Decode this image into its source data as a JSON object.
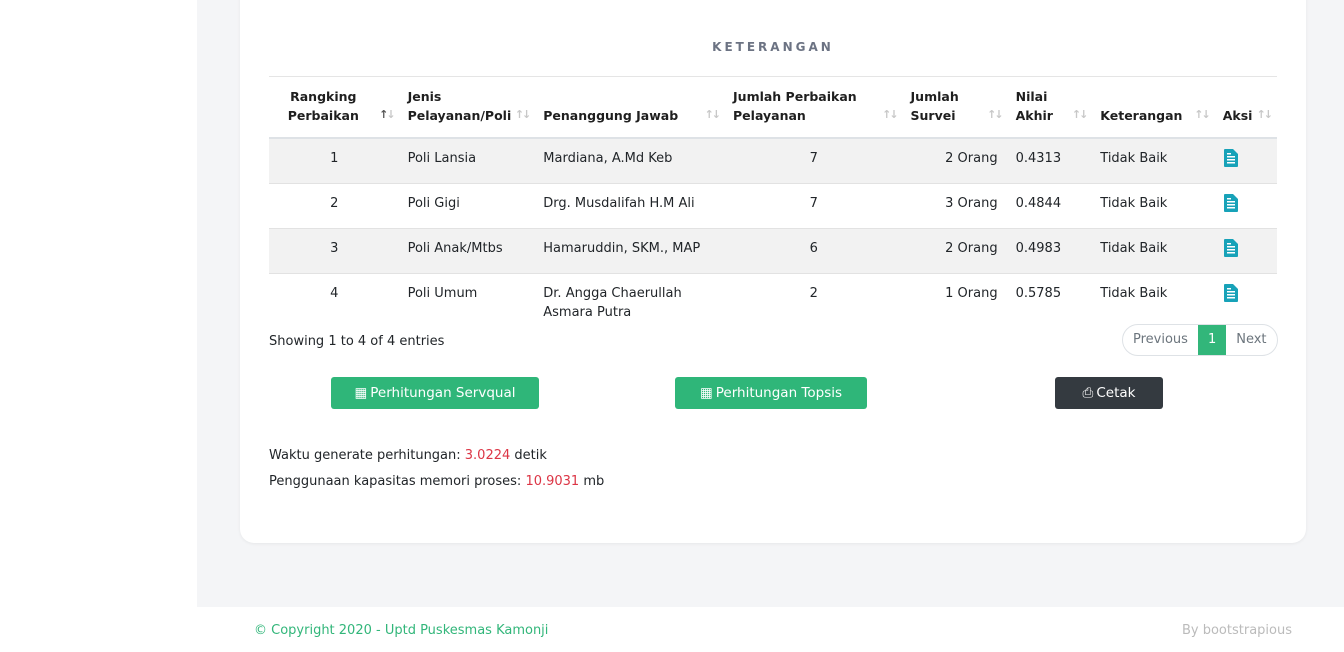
{
  "card": {
    "title": "KETERANGAN"
  },
  "table": {
    "headers": [
      {
        "line1": "Rangking",
        "line2": "Perbaikan"
      },
      {
        "line1": "Jenis",
        "line2": "Pelayanan/Poli"
      },
      {
        "line1": "",
        "line2": "Penanggung Jawab"
      },
      {
        "line1": "Jumlah Perbaikan",
        "line2": "Pelayanan"
      },
      {
        "line1": "Jumlah",
        "line2": "Survei"
      },
      {
        "line1": "Nilai",
        "line2": "Akhir"
      },
      {
        "line1": "",
        "line2": "Keterangan"
      },
      {
        "line1": "",
        "line2": "Aksi"
      }
    ],
    "rows": [
      {
        "rank": "1",
        "poli": "Poli Lansia",
        "pj1": "Mardiana, A.Md Keb",
        "pj2": "",
        "jumlah": "7",
        "survei": "2 Orang",
        "nilai": "0.4313",
        "ket": "Tidak Baik"
      },
      {
        "rank": "2",
        "poli": "Poli Gigi",
        "pj1": "Drg. Musdalifah H.M Ali",
        "pj2": "",
        "jumlah": "7",
        "survei": "3 Orang",
        "nilai": "0.4844",
        "ket": "Tidak Baik"
      },
      {
        "rank": "3",
        "poli": "Poli Anak/Mtbs",
        "pj1": "Hamaruddin, SKM., MAP",
        "pj2": "",
        "jumlah": "6",
        "survei": "2 Orang",
        "nilai": "0.4983",
        "ket": "Tidak Baik"
      },
      {
        "rank": "4",
        "poli": "Poli Umum",
        "pj1": "Dr. Angga Chaerullah",
        "pj2": "Asmara Putra",
        "jumlah": "2",
        "survei": "1 Orang",
        "nilai": "0.5785",
        "ket": "Tidak Baik"
      }
    ],
    "action_icon": "file-text-icon"
  },
  "info": "Showing 1 to 4 of 4 entries",
  "pagination": {
    "previous": "Previous",
    "current": "1",
    "next": "Next"
  },
  "buttons": {
    "servqual": "Perhitungan Servqual",
    "topsis": "Perhitungan Topsis",
    "cetak": "Cetak"
  },
  "stats": {
    "time_label": "Waktu generate perhitungan: ",
    "time_value": "3.0224",
    "time_unit": " detik",
    "mem_label": "Penggunaan kapasitas memori proses: ",
    "mem_value": "10.9031",
    "mem_unit": " mb"
  },
  "footer": {
    "copyright": "© Copyright 2020 - Uptd Puskesmas Kamonji",
    "by": "By bootstrapious"
  },
  "colors": {
    "accent": "#2fb679",
    "dark": "#343a40",
    "value": "#dc3545",
    "icon": "#17a2b8"
  }
}
